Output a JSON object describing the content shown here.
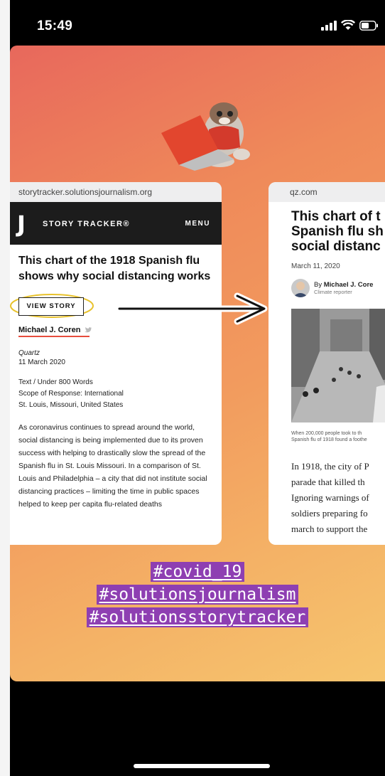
{
  "status": {
    "time": "15:49"
  },
  "left_card": {
    "url": "storytracker.solutionsjournalism.org",
    "logo": "J",
    "brand": "STORY TRACKER®",
    "menu": "MENU",
    "headline": "This chart of the 1918 Spanish flu shows why social distancing works",
    "view_story": "VIEW STORY",
    "author": "Michael J. Coren",
    "publication": "Quartz",
    "date": "11 March 2020",
    "details": [
      "Text / Under 800 Words",
      "Scope of Response: International",
      "St. Louis, Missouri, United States"
    ],
    "body": "As coronavirus continues to spread around the world, social distancing is being implemented due to its proven success with helping to drastically slow the spread of the Spanish flu in St. Louis Missouri. In a comparison of St. Louis and Philadelphia – a city that did not institute social distancing practices – limiting the time in public spaces helped to keep per capita flu-related deaths"
  },
  "right_card": {
    "url": "qz.com",
    "headline_lines": [
      "This chart of t",
      "Spanish flu sh",
      "social distanc"
    ],
    "date": "March 11, 2020",
    "by_prefix": "By ",
    "author": "Michael J. Core",
    "role": "Climate reporter",
    "caption_lines": [
      "When 200,000 people took to th",
      "Spanish flu of 1918 found a foothe"
    ],
    "body_lines": [
      "In 1918, the city of P",
      "parade that killed th",
      "Ignoring warnings of",
      "soldiers preparing fo",
      "march to support the"
    ]
  },
  "hashtags": [
    "#covid_19",
    "#solutionsjournalism",
    "#solutionsstorytracker"
  ],
  "colors": {
    "hashtag_bg": "#8e3fb2",
    "gradient_top": "#e8685c",
    "gradient_bottom": "#f6c56e"
  }
}
